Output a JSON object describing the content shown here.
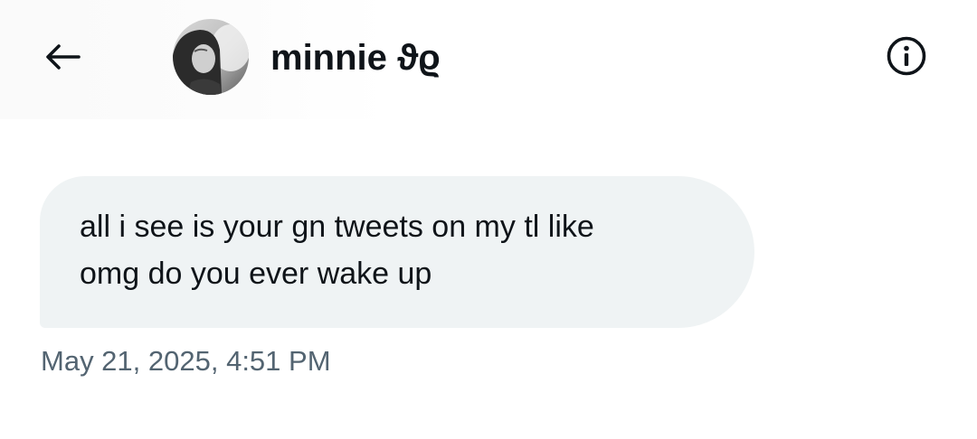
{
  "header": {
    "back_icon": "arrow-left-icon",
    "contact_name": "minnie ϑϱ",
    "avatar": "contact-avatar-photo",
    "info_icon": "info-circle-icon"
  },
  "conversation": {
    "messages": [
      {
        "lines": [
          "all i see is your gn tweets on my tl like",
          "omg do you ever wake up"
        ],
        "timestamp": "May 21, 2025, 4:51 PM"
      }
    ]
  },
  "colors": {
    "text_primary": "#0f1419",
    "text_secondary": "#536471",
    "bubble_background": "#eff3f4"
  }
}
